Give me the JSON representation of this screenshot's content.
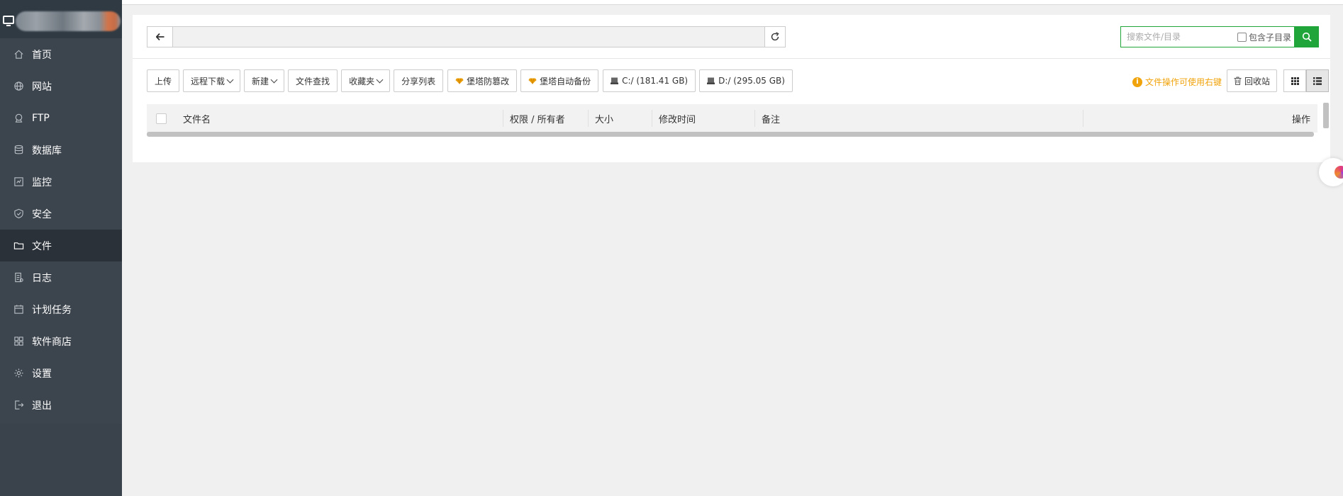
{
  "sidebar": {
    "items": [
      {
        "label": "首页",
        "icon": "home-icon"
      },
      {
        "label": "网站",
        "icon": "globe-icon"
      },
      {
        "label": "FTP",
        "icon": "ftp-icon"
      },
      {
        "label": "数据库",
        "icon": "database-icon"
      },
      {
        "label": "监控",
        "icon": "monitor-icon"
      },
      {
        "label": "安全",
        "icon": "shield-icon"
      },
      {
        "label": "文件",
        "icon": "folder-icon"
      },
      {
        "label": "日志",
        "icon": "log-icon"
      },
      {
        "label": "计划任务",
        "icon": "calendar-icon"
      },
      {
        "label": "软件商店",
        "icon": "grid-icon"
      },
      {
        "label": "设置",
        "icon": "gear-icon"
      },
      {
        "label": "退出",
        "icon": "logout-icon"
      }
    ],
    "active_index": 6
  },
  "search": {
    "placeholder": "搜索文件/目录",
    "subdir_label": "包含子目录"
  },
  "toolbar": {
    "upload": "上传",
    "remote_download": "远程下载",
    "new": "新建",
    "file_search": "文件查找",
    "favorites": "收藏夹",
    "share_list": "分享列表",
    "tamper_protect": "堡塔防篡改",
    "auto_backup": "堡塔自动备份",
    "drive_c": "C:/ (181.41 GB)",
    "drive_d": "D:/ (295.05 GB)",
    "tip": "文件操作可使用右键",
    "recycle_bin": "回收站"
  },
  "table": {
    "columns": {
      "name": "文件名",
      "permission": "权限 / 所有者",
      "size": "大小",
      "mtime": "修改时间",
      "note": "备注",
      "ops": "操作"
    }
  },
  "colors": {
    "sidebar_bg": "#3c444d",
    "sidebar_active": "#2a3138",
    "accent_green": "#20a53a",
    "tip_orange": "#f0a30a"
  }
}
